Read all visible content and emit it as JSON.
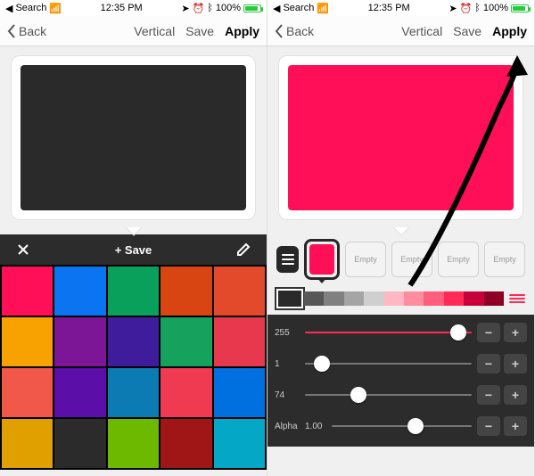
{
  "status": {
    "search": "Search",
    "time": "12:35 PM",
    "battery_pct": "100%"
  },
  "nav": {
    "back": "Back",
    "vertical": "Vertical",
    "save": "Save",
    "apply": "Apply"
  },
  "palette_header": {
    "save_label": "+ Save"
  },
  "preview1_color": "#2a2a2a",
  "preview2_color": "#ff0f57",
  "palette_colors": [
    "#ff0f57",
    "#0b74f0",
    "#09a05b",
    "#d84512",
    "#e24a2b",
    "#f7a200",
    "#7c1596",
    "#3f1c9c",
    "#16a15d",
    "#e8384d",
    "#f1584a",
    "#5b0ea8",
    "#0c7ab3",
    "#ef3a52",
    "#0070e0",
    "#e0a000",
    "#2b2b2b",
    "#6db900",
    "#a01616",
    "#05a7c7"
  ],
  "swatch_slots": {
    "active_color": "#ff0f57",
    "empty_label": "Empty"
  },
  "tints": [
    "#2a2a2a",
    "#575757",
    "#808080",
    "#a5a5a5",
    "#cfcfcf",
    "#ffb7c4",
    "#ff8da0",
    "#ff5e7d",
    "#ff2a56",
    "#c7003a",
    "#8e0024"
  ],
  "slider1": {
    "label": "255",
    "pos": 0.92
  },
  "slider2": {
    "label": "1",
    "pos": 0.1
  },
  "slider3": {
    "label": "74",
    "pos": 0.32
  },
  "alpha": {
    "label": "Alpha",
    "value": "1.00",
    "pos": 0.6
  }
}
